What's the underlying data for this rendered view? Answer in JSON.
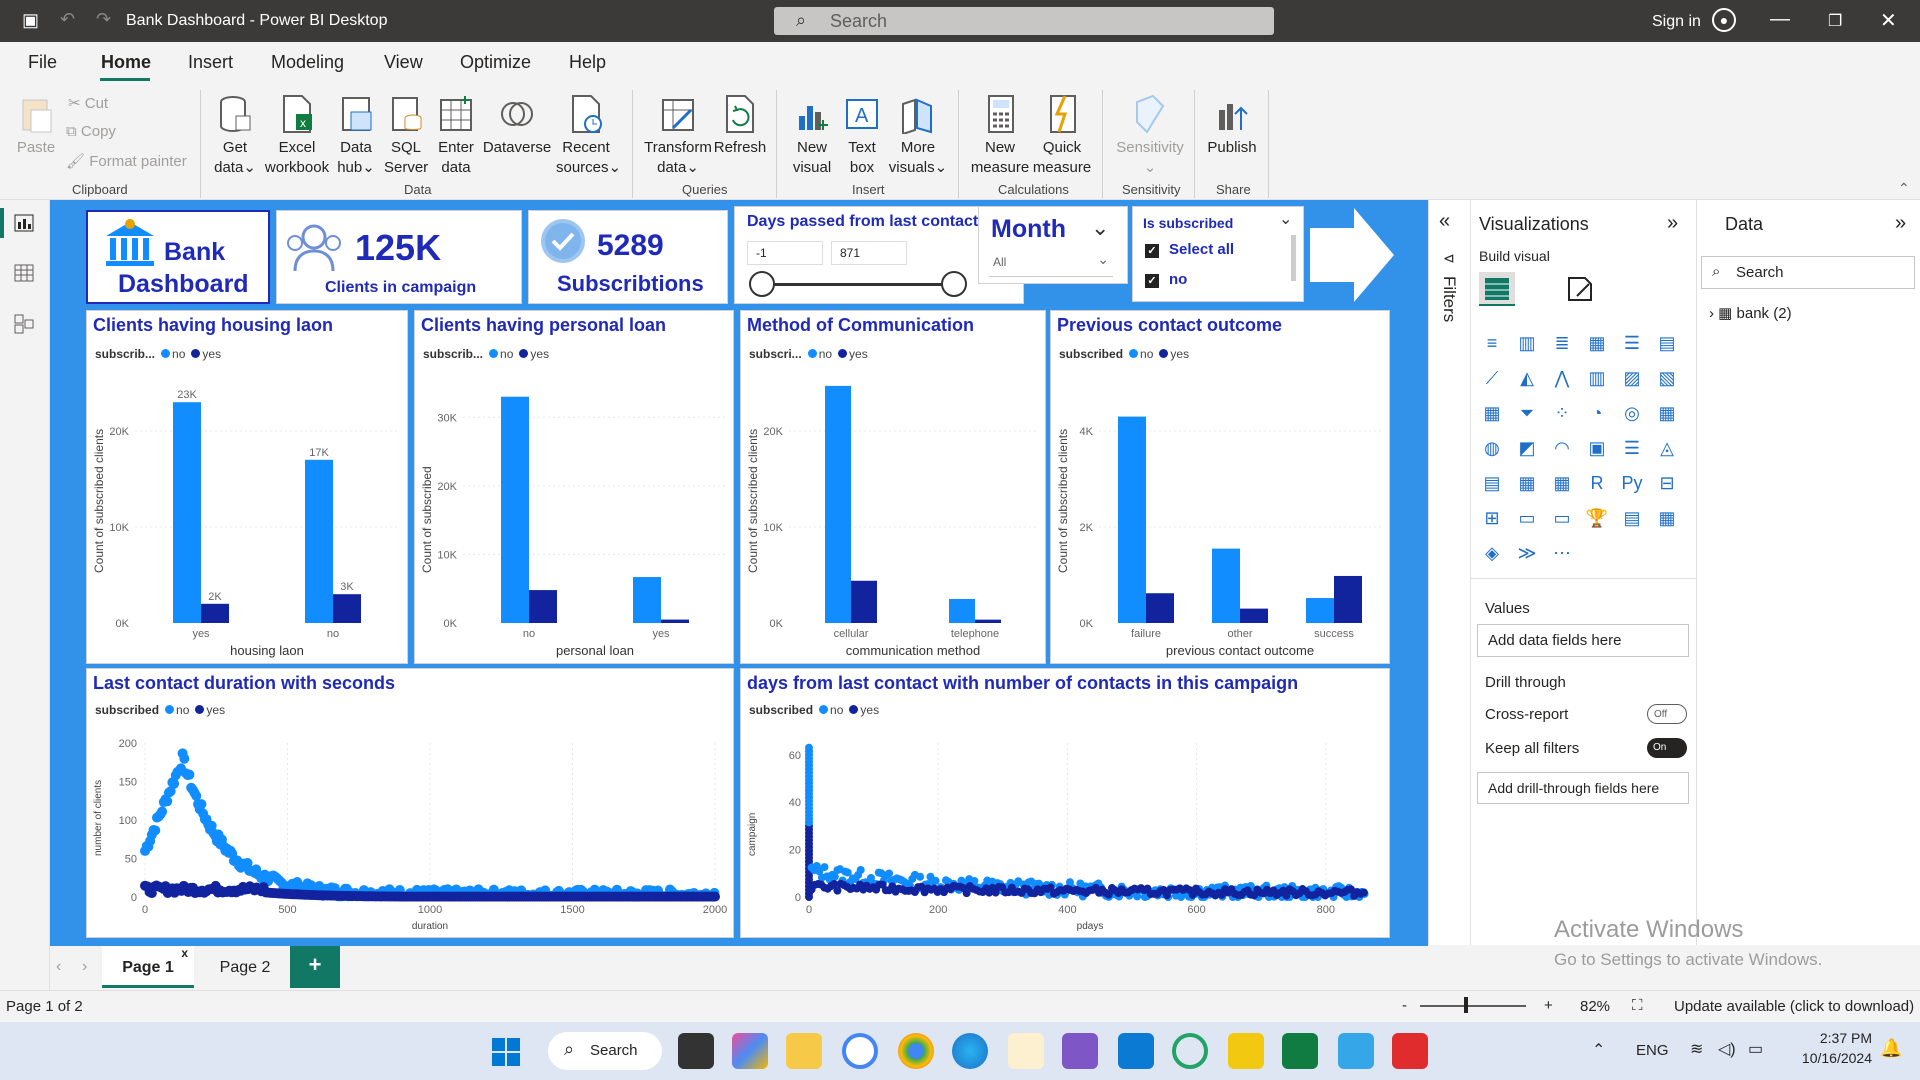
{
  "titlebar": {
    "title": "Bank Dashboard - Power BI Desktop",
    "search": "Search",
    "signin": "Sign in"
  },
  "menu": [
    "File",
    "Home",
    "Insert",
    "Modeling",
    "View",
    "Optimize",
    "Help"
  ],
  "ribbon": {
    "paste": "Paste",
    "cut": "Cut",
    "copy": "Copy",
    "format_painter": "Format painter",
    "get_data": [
      "Get",
      "data"
    ],
    "excel": [
      "Excel",
      "workbook"
    ],
    "data_hub": [
      "Data",
      "hub"
    ],
    "sql": [
      "SQL",
      "Server"
    ],
    "enter_data": [
      "Enter",
      "data"
    ],
    "dataverse": "Dataverse",
    "recent": [
      "Recent",
      "sources"
    ],
    "transform": [
      "Transform",
      "data"
    ],
    "refresh": "Refresh",
    "new_visual": [
      "New",
      "visual"
    ],
    "text_box": [
      "Text",
      "box"
    ],
    "more_visuals": [
      "More",
      "visuals"
    ],
    "new_measure": [
      "New",
      "measure"
    ],
    "quick_measure": [
      "Quick",
      "measure"
    ],
    "sensitivity": "Sensitivity",
    "publish": "Publish",
    "groups": [
      "Clipboard",
      "Data",
      "Queries",
      "Insert",
      "Calculations",
      "Sensitivity",
      "Share"
    ]
  },
  "kpis": {
    "bank_title": [
      "Bank",
      "Dashboard"
    ],
    "clients_value": "125K",
    "clients_label": "Clients in campaign",
    "subs_value": "5289",
    "subs_label": "Subscribtions"
  },
  "slicers": {
    "days_title": "Days passed from last contact",
    "days_min": "-1",
    "days_max": "871",
    "month_title": "Month",
    "month_value": "All",
    "subscribed_title": "Is subscribed",
    "opt1": "Select all",
    "opt2": "no"
  },
  "legend": {
    "label_full": "subscribed",
    "label_short": "subscrib...",
    "label_short2": "subscri...",
    "no": "no",
    "yes": "yes"
  },
  "colors": {
    "no": "#118dff",
    "yes": "#12239e"
  },
  "visuals": {
    "housing": {
      "title": "Clients having housing laon"
    },
    "personal": {
      "title": "Clients having personal loan"
    },
    "comm": {
      "title": "Method of Communication"
    },
    "prev": {
      "title": "Previous contact outcome"
    },
    "duration": {
      "title": "Last contact duration with seconds"
    },
    "pdays": {
      "title": "days from last contact with number of contacts in this campaign"
    }
  },
  "chart_data": [
    {
      "type": "bar",
      "title": "Clients having housing laon",
      "xlabel": "housing laon",
      "ylabel": "Count of subscribed clients",
      "categories": [
        "yes",
        "no"
      ],
      "ylim": [
        0,
        25000
      ],
      "yticks": [
        "0K",
        "10K",
        "20K"
      ],
      "series": [
        {
          "name": "no",
          "values": [
            23000,
            17000
          ]
        },
        {
          "name": "yes",
          "values": [
            2000,
            3000
          ]
        }
      ],
      "data_labels": [
        [
          "23K",
          "17K"
        ],
        [
          "2K",
          "3K"
        ]
      ]
    },
    {
      "type": "bar",
      "title": "Clients having personal loan",
      "xlabel": "personal loan",
      "ylabel": "Count of subscribed",
      "categories": [
        "no",
        "yes"
      ],
      "ylim": [
        0,
        35000
      ],
      "yticks": [
        "0K",
        "10K",
        "20K",
        "30K"
      ],
      "series": [
        {
          "name": "no",
          "values": [
            33000,
            6700
          ]
        },
        {
          "name": "yes",
          "values": [
            4800,
            500
          ]
        }
      ]
    },
    {
      "type": "bar",
      "title": "Method of Communication",
      "xlabel": "communication method",
      "ylabel": "Count of subscribed clients",
      "categories": [
        "cellular",
        "telephone"
      ],
      "ylim": [
        0,
        25000
      ],
      "yticks": [
        "0K",
        "10K",
        "20K"
      ],
      "series": [
        {
          "name": "no",
          "values": [
            24700,
            2500
          ]
        },
        {
          "name": "yes",
          "values": [
            4400,
            350
          ]
        }
      ]
    },
    {
      "type": "bar",
      "title": "Previous contact outcome",
      "xlabel": "previous contact outcome",
      "ylabel": "Count of subscribed clients",
      "categories": [
        "failure",
        "other",
        "success"
      ],
      "ylim": [
        0,
        5000
      ],
      "yticks": [
        "0K",
        "2K",
        "4K"
      ],
      "series": [
        {
          "name": "no",
          "values": [
            4300,
            1550,
            520
          ]
        },
        {
          "name": "yes",
          "values": [
            620,
            300,
            980
          ]
        }
      ]
    },
    {
      "type": "scatter",
      "title": "Last contact duration with seconds",
      "xlabel": "duration",
      "ylabel": "number of clients",
      "xlim": [
        0,
        2000
      ],
      "ylim": [
        0,
        200
      ],
      "xticks": [
        "0",
        "500",
        "1000",
        "1500",
        "2000"
      ],
      "yticks": [
        "0",
        "50",
        "100",
        "150",
        "200"
      ],
      "series": [
        {
          "name": "no",
          "shape": "peak 180 near 130s, decays to ~5 by 700s"
        },
        {
          "name": "yes",
          "shape": "flat ~15 from 100-400s, near 0 after"
        }
      ]
    },
    {
      "type": "scatter",
      "title": "days from last contact with number of contacts in this campaign",
      "xlabel": "pdays",
      "ylabel": "campaign",
      "xlim": [
        0,
        870
      ],
      "ylim": [
        0,
        65
      ],
      "xticks": [
        "0",
        "200",
        "400",
        "600",
        "800"
      ],
      "yticks": [
        "0",
        "20",
        "40",
        "60"
      ],
      "series": [
        {
          "name": "no",
          "shape": "vertical spread at pdays 0 up to 63, otherwise 0-10"
        },
        {
          "name": "yes",
          "shape": "0-6 across range"
        }
      ]
    }
  ],
  "panes": {
    "filters": "Filters",
    "viz_title": "Visualizations",
    "build_visual": "Build visual",
    "values": "Values",
    "add_fields": "Add data fields here",
    "drill_through": "Drill through",
    "cross_report": "Cross-report",
    "cross_state": "Off",
    "keep_filters": "Keep all filters",
    "keep_state": "On",
    "add_drill": "Add drill-through fields here",
    "data_title": "Data",
    "data_search": "Search",
    "table": "bank (2)"
  },
  "pages": {
    "p1": "Page 1",
    "p2": "Page 2",
    "add": "+"
  },
  "status": {
    "page": "Page 1 of 2",
    "zoom": "82%",
    "update": "Update available (click to download)"
  },
  "watermark": {
    "l1": "Activate Windows",
    "l2": "Go to Settings to activate Windows."
  },
  "taskbar": {
    "search": "Search",
    "lang": "ENG",
    "time": "2:37 PM",
    "date": "10/16/2024"
  }
}
